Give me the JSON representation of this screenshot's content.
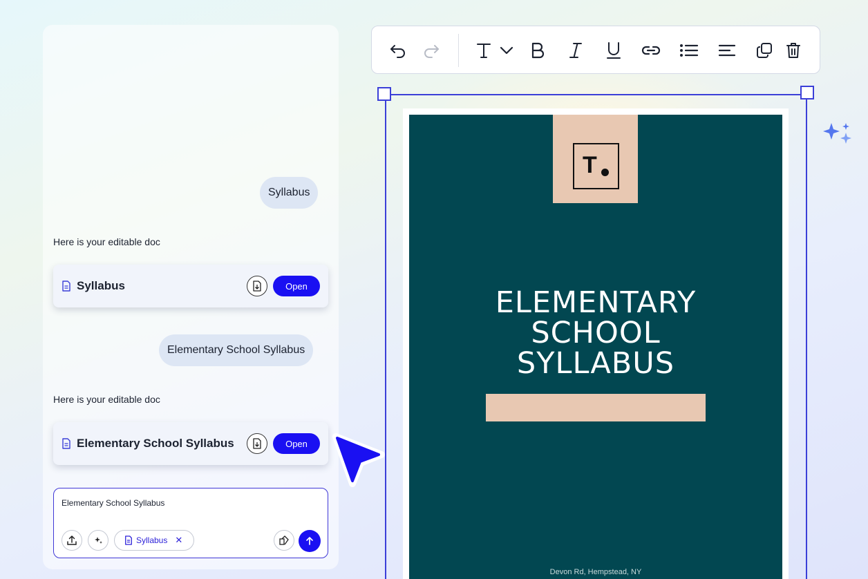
{
  "chat": {
    "messages": [
      {
        "role": "user",
        "text": "Syllabus"
      },
      {
        "role": "assistant",
        "text": "Here is your editable doc",
        "doc_title": "Syllabus",
        "open_label": "Open"
      },
      {
        "role": "user",
        "text": "Elementary School Syllabus"
      },
      {
        "role": "assistant",
        "text": "Here is your editable doc",
        "doc_title": "Elementary School Syllabus",
        "open_label": "Open"
      }
    ]
  },
  "composer": {
    "value": "Elementary School Syllabus",
    "attachment_chip": "Syllabus"
  },
  "toolbar": {
    "tools": [
      "undo-icon",
      "redo-icon",
      "text-style-icon",
      "chevron-down-icon",
      "bold-icon",
      "italic-icon",
      "underline-icon",
      "link-icon",
      "bullet-list-icon",
      "align-left-icon",
      "duplicate-icon",
      "delete-icon"
    ]
  },
  "document": {
    "logo_text": "T",
    "title_lines": [
      "ELEMENTARY",
      "SCHOOL",
      "SYLLABUS"
    ],
    "address": "Devon Rd, Hempstead, NY"
  },
  "colors": {
    "accent": "#1a10f2",
    "selection": "#3b3fd8",
    "cover_bg": "#024751",
    "cover_accent": "#e8c8b2",
    "bubble_bg": "#dde6f4"
  }
}
